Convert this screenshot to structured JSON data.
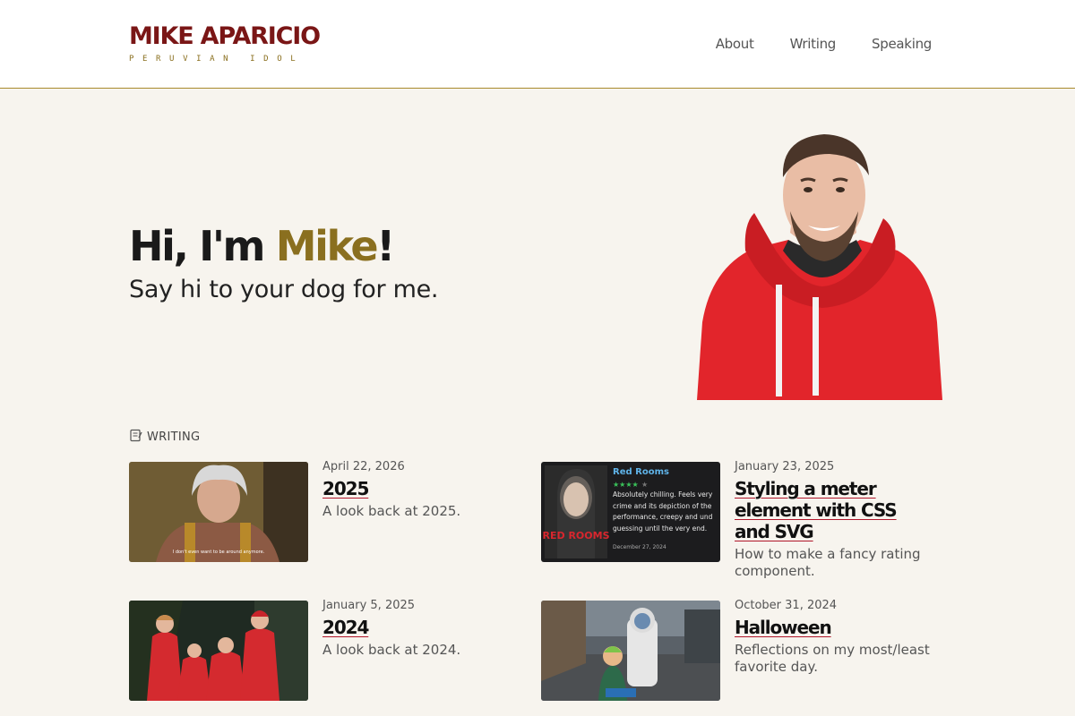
{
  "header": {
    "logo_title": "MIKE APARICIO",
    "logo_subtitle": "PERUVIAN IDOL",
    "nav": [
      {
        "label": "About"
      },
      {
        "label": "Writing"
      },
      {
        "label": "Speaking"
      }
    ]
  },
  "hero": {
    "greeting_prefix": "Hi, I'm ",
    "greeting_name": "Mike",
    "greeting_suffix": "!",
    "tagline": "Say hi to your dog for me."
  },
  "writing": {
    "section_label": "WRITING",
    "posts": [
      {
        "date": "April 22, 2026",
        "title": "2025",
        "description": "A look back at 2025.",
        "thumb_caption": "I don't even want to be around anymore."
      },
      {
        "date": "January 23, 2025",
        "title": "Styling a meter element with CSS and SVG",
        "description": "How to make a fancy rating component.",
        "thumb": {
          "heading": "Red Rooms",
          "poster_text": "RED ROOMS",
          "review": "Absolutely chilling. Feels very crime and its depiction of the performance, creepy and und guessing until the very end.",
          "review_date": "December 27, 2024",
          "rating_stars": 4
        }
      },
      {
        "date": "January 5, 2025",
        "title": "2024",
        "description": "A look back at 2024."
      },
      {
        "date": "October 31, 2024",
        "title": "Halloween",
        "description": "Reflections on my most/least favorite day."
      }
    ]
  },
  "colors": {
    "brand": "#7a1616",
    "accent": "#8a6f1f",
    "background": "#f7f4ee",
    "underline": "#b0162a"
  }
}
